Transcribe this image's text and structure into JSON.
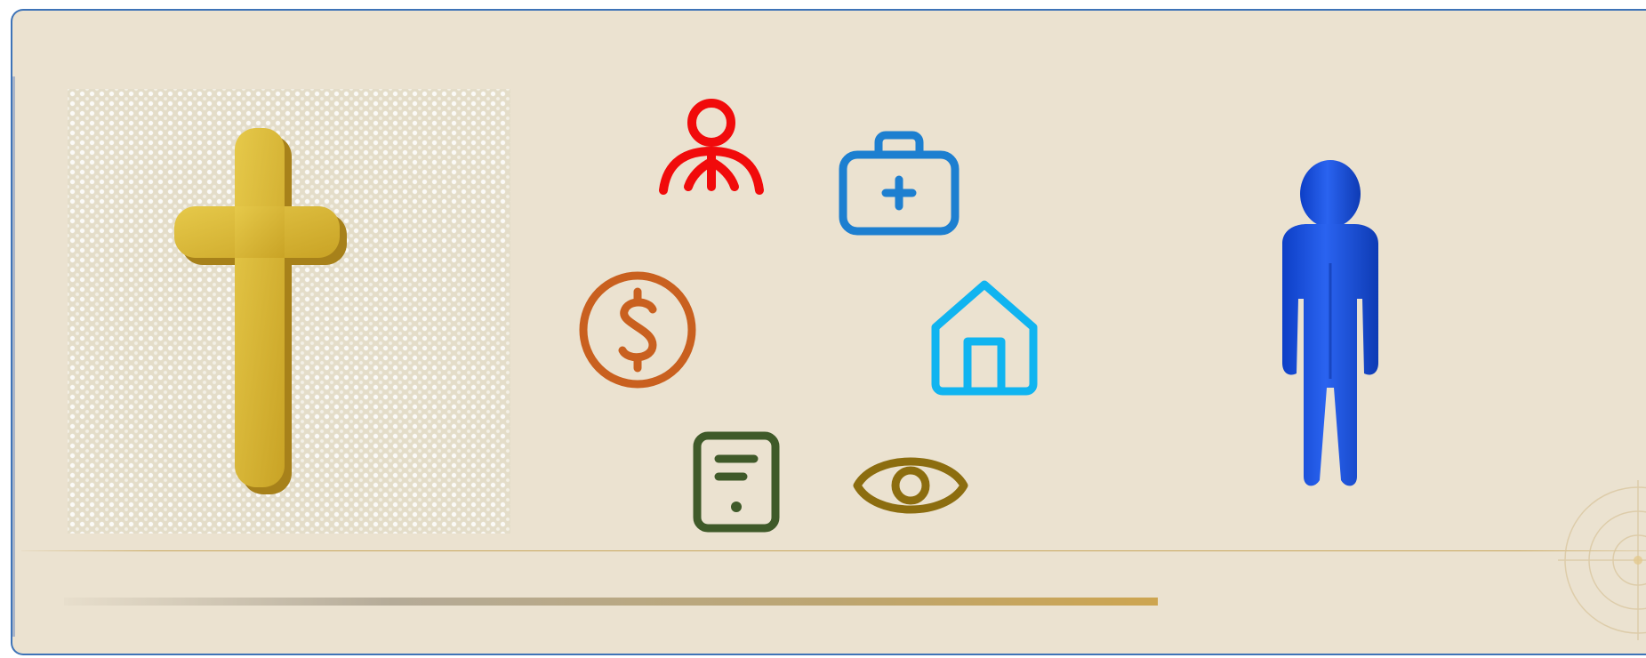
{
  "slide": {
    "background": "#ebe2d0",
    "border_color": "#3e73b7"
  },
  "icons": [
    {
      "name": "christian-cross-icon",
      "color": "#d2b030"
    },
    {
      "name": "person-support-icon",
      "color": "#f10b0b"
    },
    {
      "name": "medical-kit-icon",
      "color": "#1d7fd0"
    },
    {
      "name": "dollar-coin-icon",
      "color": "#c9601f"
    },
    {
      "name": "home-icon",
      "color": "#10b4f0"
    },
    {
      "name": "document-phone-icon",
      "color": "#3f5a29"
    },
    {
      "name": "eye-icon",
      "color": "#8c6d0f"
    },
    {
      "name": "person-figure-icon",
      "color": "#1450e0"
    }
  ],
  "decorations": {
    "rule_color": "#c9a85f",
    "bar_end_color": "#cda550"
  }
}
